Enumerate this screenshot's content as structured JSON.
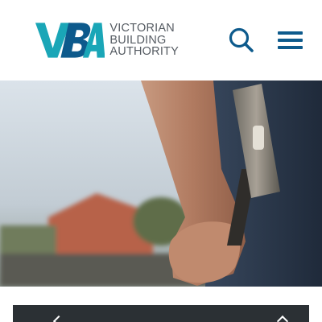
{
  "header": {
    "logo": {
      "mark_text": "VBA",
      "name_lines": [
        "VICTORIAN",
        "BUILDING",
        "AUTHORITY"
      ]
    },
    "search_icon": "search-icon",
    "menu_icon": "hamburger-menu-icon"
  },
  "hero": {
    "image": "photo of a hand gripping a hammer"
  },
  "colors": {
    "brand_teal": "#1aa6b7",
    "brand_blue": "#0d5a8c",
    "logo_text": "#555b62",
    "bottom_bar": "#2b3034"
  }
}
